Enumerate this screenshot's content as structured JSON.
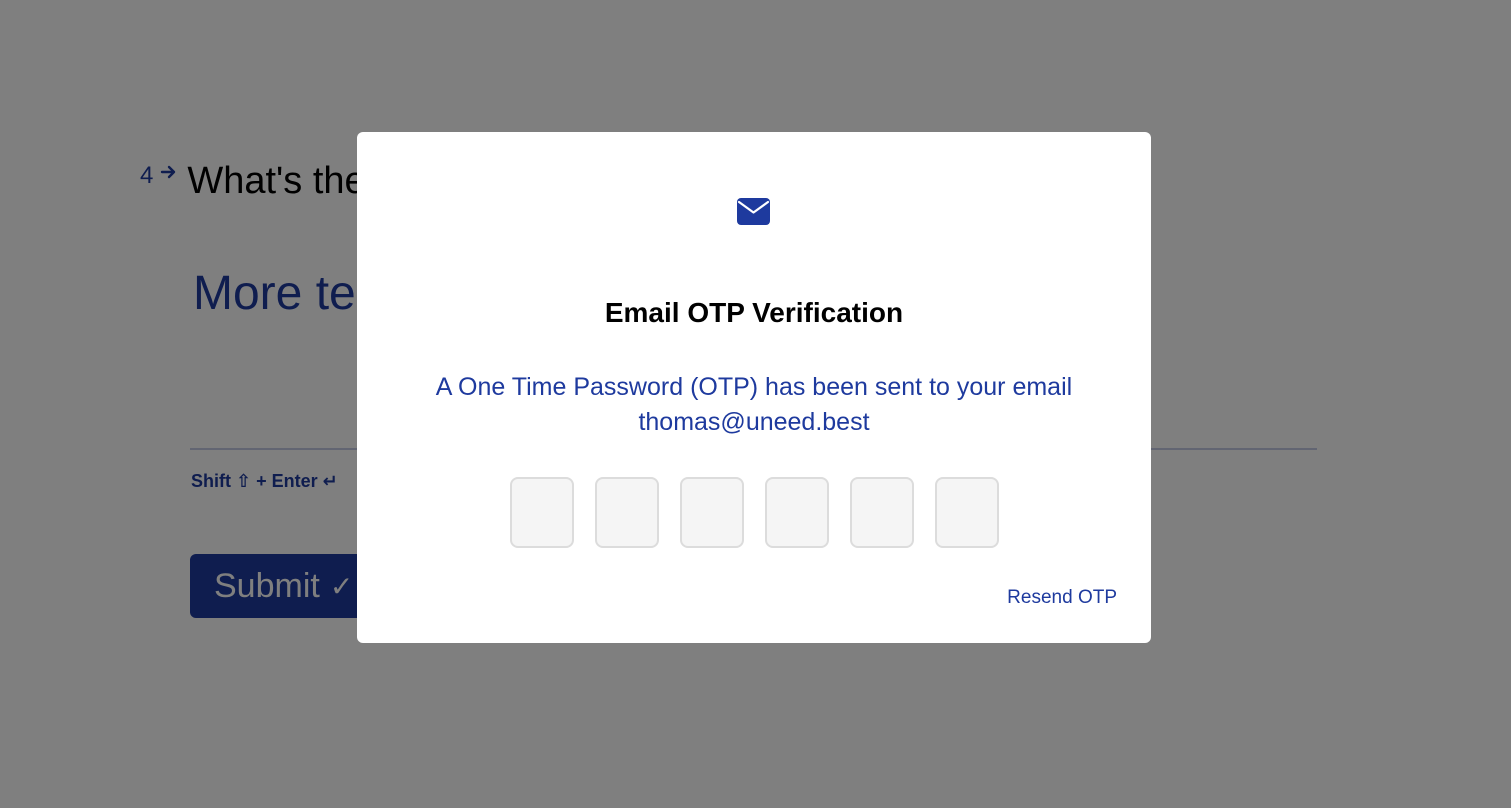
{
  "form": {
    "question_number": "4",
    "question_text": "What's the",
    "answer_placeholder": "More te",
    "hint_text": "Shift ⇧ + Enter ↵",
    "submit_label": "Submit",
    "submit_check": "✓"
  },
  "modal": {
    "icon": "envelope-icon",
    "title": "Email OTP Verification",
    "message_line1": "A One Time Password (OTP) has been sent to your email",
    "email": "thomas@uneed.best",
    "otp_length": 6,
    "otp_values": [
      "",
      "",
      "",
      "",
      "",
      ""
    ],
    "resend_label": "Resend OTP"
  },
  "colors": {
    "accent": "#1e3a9e",
    "overlay": "rgba(0,0,0,0.5)",
    "input_bg": "#f5f5f5",
    "input_border": "#dcdcdc"
  }
}
